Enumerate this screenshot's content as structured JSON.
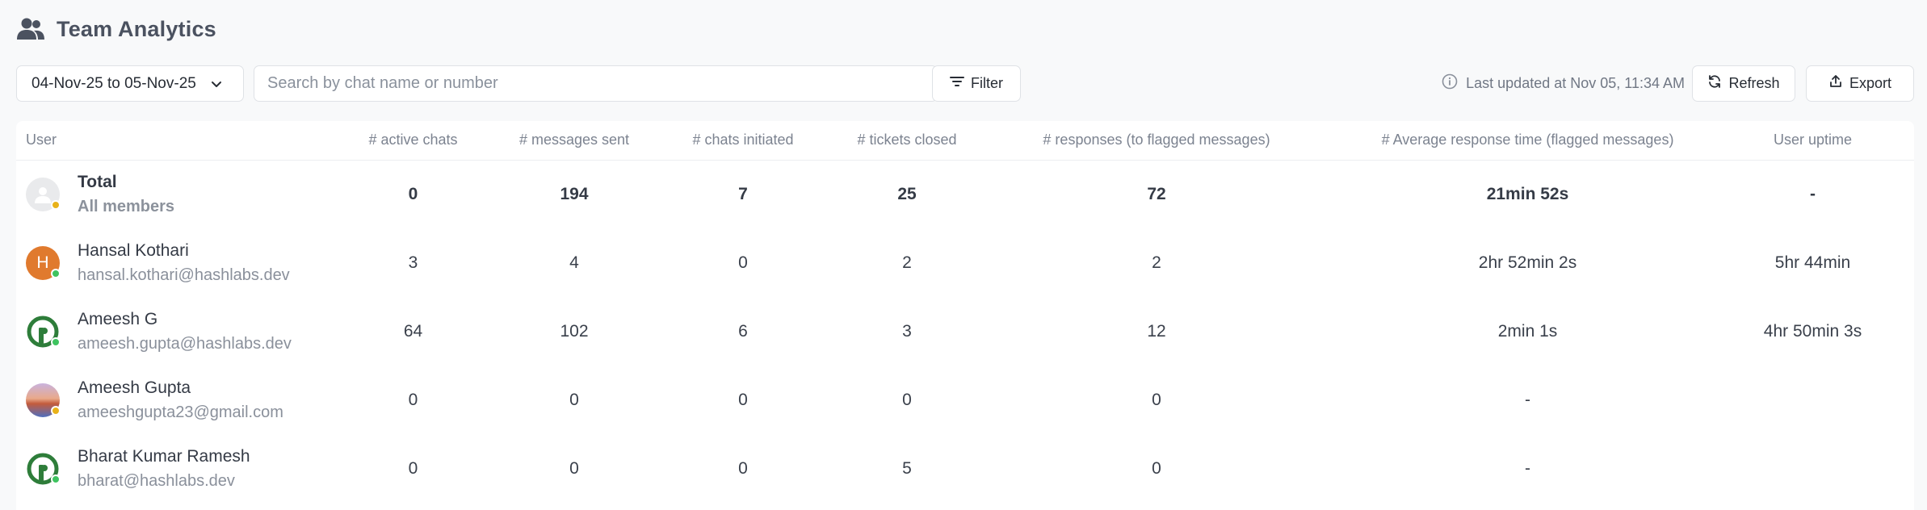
{
  "page": {
    "title": "Team Analytics",
    "title_icon": "users-icon"
  },
  "toolbar": {
    "date_range": "04-Nov-25 to 05-Nov-25",
    "search_placeholder": "Search by chat name or number",
    "search_value": "",
    "filter_label": "Filter",
    "last_updated": "Last updated at Nov 05, 11:34 AM",
    "refresh_label": "Refresh",
    "export_label": "Export"
  },
  "table": {
    "headers": {
      "user": "User",
      "active_chats": "# active chats",
      "messages_sent": "# messages sent",
      "chats_initiated": "# chats initiated",
      "tickets_closed": "# tickets closed",
      "responses_flagged": "# responses (to flagged messages)",
      "avg_response_time": "# Average response time (flagged messages)",
      "user_uptime": "User uptime"
    },
    "rows": [
      {
        "name": "Total",
        "sub": "All members",
        "avatar": "placeholder-avatar",
        "status": "away",
        "active_chats": "0",
        "messages_sent": "194",
        "chats_initiated": "7",
        "tickets_closed": "25",
        "responses_flagged": "72",
        "avg_response_time": "21min 52s",
        "user_uptime": "-"
      },
      {
        "name": "Hansal Kothari",
        "sub": "hansal.kothari@hashlabs.dev",
        "avatar": "H",
        "status": "online",
        "active_chats": "3",
        "messages_sent": "4",
        "chats_initiated": "0",
        "tickets_closed": "2",
        "responses_flagged": "2",
        "avg_response_time": "2hr 52min 2s",
        "user_uptime": "5hr 44min"
      },
      {
        "name": "Ameesh G",
        "sub": "ameesh.gupta@hashlabs.dev",
        "avatar": "hashlabs-logo",
        "status": "online",
        "active_chats": "64",
        "messages_sent": "102",
        "chats_initiated": "6",
        "tickets_closed": "3",
        "responses_flagged": "12",
        "avg_response_time": "2min 1s",
        "user_uptime": "4hr 50min 3s"
      },
      {
        "name": "Ameesh Gupta",
        "sub": "ameeshgupta23@gmail.com",
        "avatar": "photo-avatar",
        "status": "away",
        "active_chats": "0",
        "messages_sent": "0",
        "chats_initiated": "0",
        "tickets_closed": "0",
        "responses_flagged": "0",
        "avg_response_time": "-",
        "user_uptime": ""
      },
      {
        "name": "Bharat Kumar Ramesh",
        "sub": "bharat@hashlabs.dev",
        "avatar": "hashlabs-logo",
        "status": "online",
        "active_chats": "0",
        "messages_sent": "0",
        "chats_initiated": "0",
        "tickets_closed": "5",
        "responses_flagged": "0",
        "avg_response_time": "-",
        "user_uptime": ""
      }
    ]
  },
  "colors": {
    "online": "#3ec35f",
    "away": "#e8b21a",
    "hansal_avatar": "#e07a2e",
    "hashlabs_green": "#2e7d3a"
  }
}
